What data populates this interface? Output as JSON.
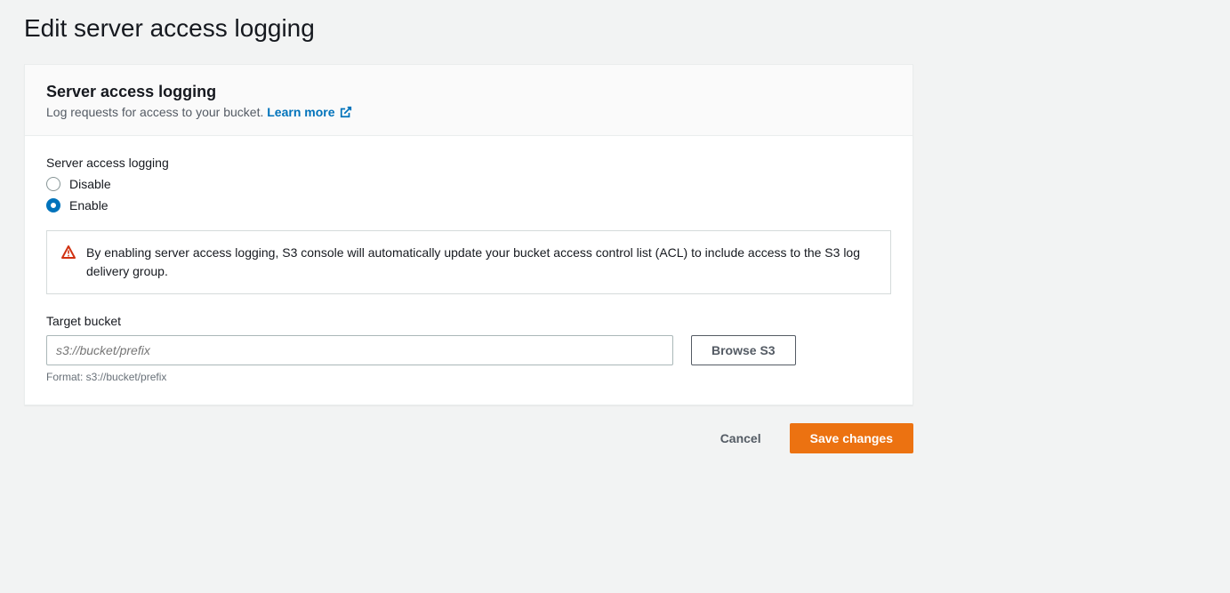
{
  "page": {
    "title": "Edit server access logging"
  },
  "panel": {
    "title": "Server access logging",
    "description": "Log requests for access to your bucket.",
    "learn_more": "Learn more"
  },
  "form": {
    "section_label": "Server access logging",
    "radio": {
      "disable": "Disable",
      "enable": "Enable"
    },
    "alert": "By enabling server access logging, S3 console will automatically update your bucket access control list (ACL) to include access to the S3 log delivery group.",
    "target": {
      "label": "Target bucket",
      "placeholder": "s3://bucket/prefix",
      "value": "",
      "browse": "Browse S3",
      "format": "Format: s3://bucket/prefix"
    }
  },
  "footer": {
    "cancel": "Cancel",
    "save": "Save changes"
  }
}
